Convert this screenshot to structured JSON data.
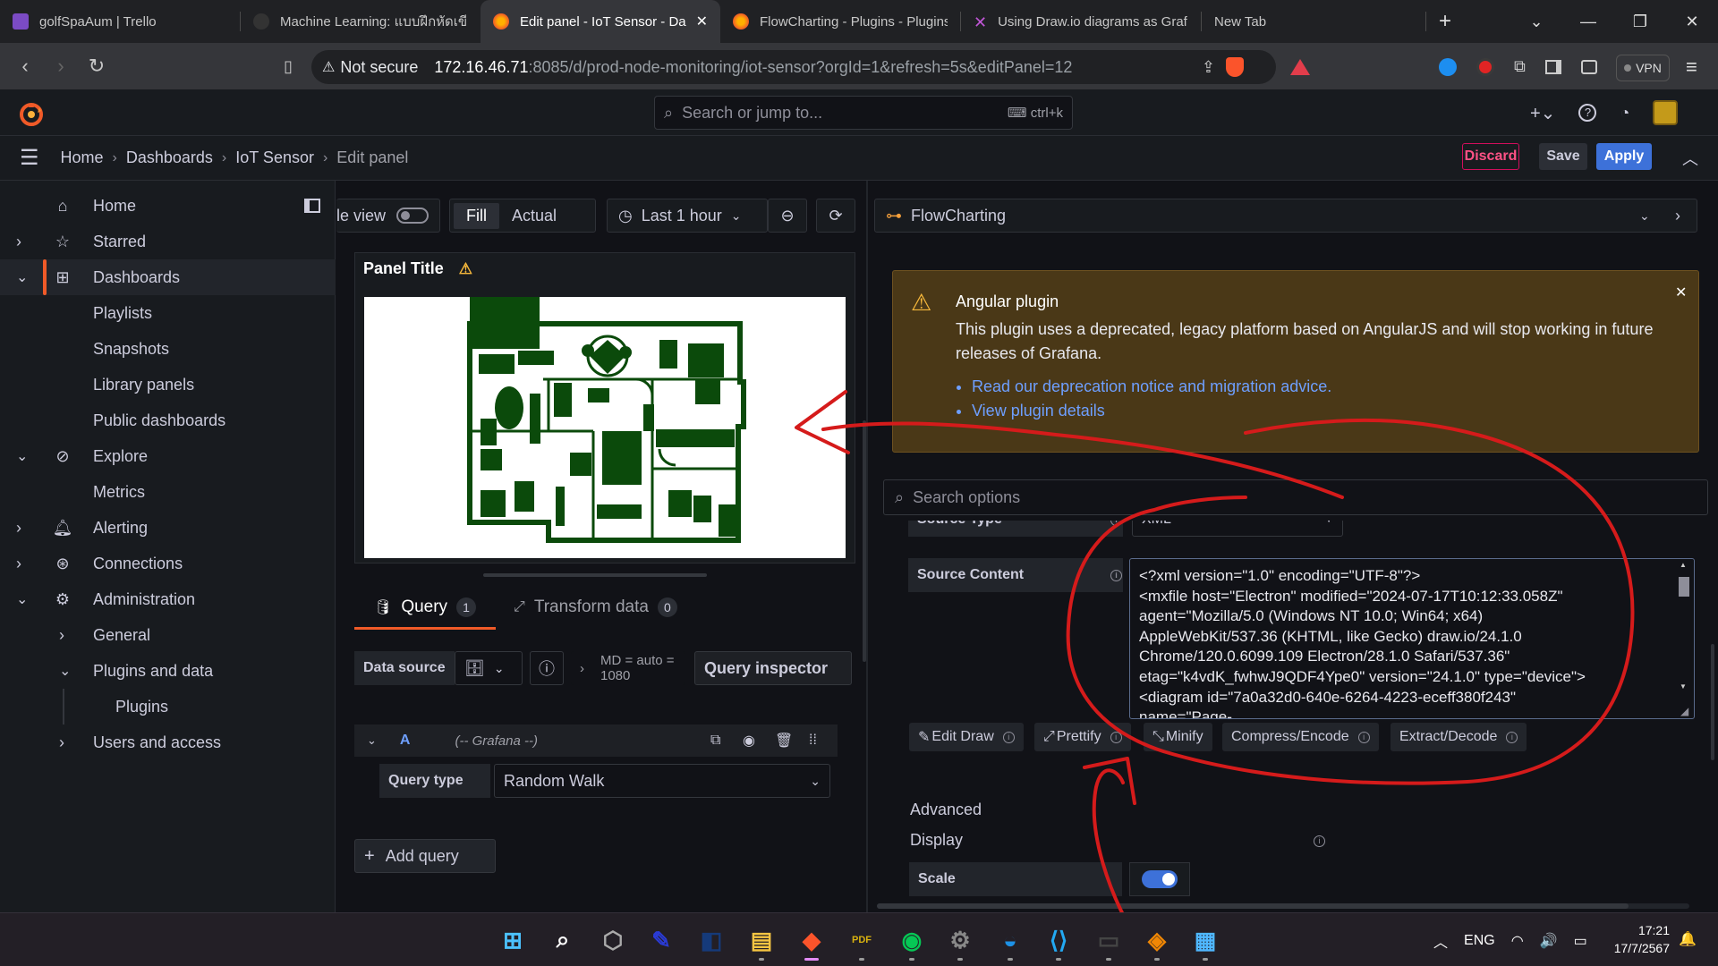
{
  "browser": {
    "tabs": [
      {
        "title": "golfSpaAum | Trello",
        "icon": "trello-icon",
        "color": "#7b4bc4"
      },
      {
        "title": "Machine Learning: แบบฝึกหัดเขียน",
        "icon": "github-icon",
        "color": "#333333"
      },
      {
        "title": "Edit panel - IoT Sensor - Da",
        "icon": "grafana-icon",
        "color": "#f05a28",
        "active": true
      },
      {
        "title": "FlowCharting - Plugins - Plugins",
        "icon": "grafana-icon",
        "color": "#f05a28"
      },
      {
        "title": "Using Draw.io diagrams as Graf",
        "icon": "close-x-icon",
        "color": "#c056d6"
      },
      {
        "title": "New Tab",
        "icon": "",
        "color": ""
      }
    ],
    "security_label": "Not secure",
    "url_host": "172.16.46.71",
    "url_path": ":8085/d/prod-node-monitoring/iot-sensor?orgId=1&refresh=5s&editPanel=12",
    "vpn_label": "VPN"
  },
  "grafana": {
    "search_placeholder": "Search or jump to...",
    "search_shortcut": "ctrl+k",
    "breadcrumb": [
      "Home",
      "Dashboards",
      "IoT Sensor",
      "Edit panel"
    ],
    "buttons": {
      "discard": "Discard",
      "save": "Save",
      "apply": "Apply"
    },
    "sidebar": [
      {
        "label": "Home",
        "icon": "home-icon",
        "level": 0,
        "chevron": ""
      },
      {
        "label": "Starred",
        "icon": "star-icon",
        "level": 0,
        "chevron": "right"
      },
      {
        "label": "Dashboards",
        "icon": "dashboards-icon",
        "level": 0,
        "chevron": "down",
        "active": true
      },
      {
        "label": "Playlists",
        "level": 1
      },
      {
        "label": "Snapshots",
        "level": 1
      },
      {
        "label": "Library panels",
        "level": 1
      },
      {
        "label": "Public dashboards",
        "level": 1
      },
      {
        "label": "Explore",
        "icon": "compass-icon",
        "level": 0,
        "chevron": "down"
      },
      {
        "label": "Metrics",
        "level": 1
      },
      {
        "label": "Alerting",
        "icon": "bell-icon",
        "level": 0,
        "chevron": "right"
      },
      {
        "label": "Connections",
        "icon": "connections-icon",
        "level": 0,
        "chevron": "right"
      },
      {
        "label": "Administration",
        "icon": "gear-icon",
        "level": 0,
        "chevron": "down"
      },
      {
        "label": "General",
        "level": 1,
        "chevron": "right"
      },
      {
        "label": "Plugins and data",
        "level": 1,
        "chevron": "down"
      },
      {
        "label": "Plugins",
        "level": 2
      },
      {
        "label": "Users and access",
        "level": 1,
        "chevron": "right"
      }
    ],
    "toolbar": {
      "table_view": "le view",
      "fill": "Fill",
      "actual": "Actual",
      "time_range": "Last 1 hour"
    },
    "panel": {
      "title": "Panel Title"
    },
    "query_tabs": {
      "query": "Query",
      "query_count": "1",
      "transform": "Transform data",
      "transform_count": "0"
    },
    "data_source": {
      "label": "Data source",
      "meta": "MD = auto = 1080",
      "inspector": "Query inspector"
    },
    "query_row": {
      "letter": "A",
      "source": "(-- Grafana --)",
      "query_type_label": "Query type",
      "query_type_value": "Random Walk"
    },
    "add_query": "Add query",
    "options": {
      "viz_name": "FlowCharting",
      "warning": {
        "title": "Angular plugin",
        "body": "This plugin uses a deprecated, legacy platform based on AngularJS and will stop working in future releases of Grafana.",
        "links": [
          "Read our deprecation notice and migration advice.",
          "View plugin details"
        ]
      },
      "search_placeholder": "Search options",
      "source_type_label": "Source Type",
      "source_type_value": "XML",
      "source_content_label": "Source Content",
      "source_content": "<?xml version=\"1.0\" encoding=\"UTF-8\"?>\n<mxfile host=\"Electron\" modified=\"2024-07-17T10:12:33.058Z\"\nagent=\"Mozilla/5.0 (Windows NT 10.0; Win64; x64)\nAppleWebKit/537.36 (KHTML, like Gecko) draw.io/24.1.0\nChrome/120.0.6099.109 Electron/28.1.0 Safari/537.36\"\netag=\"k4vdK_fwhwJ9QDF4Ype0\" version=\"24.1.0\" type=\"device\">\n<diagram id=\"7a0a32d0-640e-6264-4223-eceff380f243\"\nname=\"Page-",
      "actions": [
        "Edit Draw",
        "Prettify",
        "Minify",
        "Compress/Encode",
        "Extract/Decode"
      ],
      "advanced_label": "Advanced",
      "display_label": "Display",
      "scale_label": "Scale",
      "scale_on": true
    }
  },
  "taskbar": {
    "lang": "ENG",
    "time": "17:21",
    "date": "17/7/2567"
  },
  "colors": {
    "accent": "#f05a28",
    "primary": "#3d71d9",
    "warning_bg": "#4a3817",
    "annotation": "#d51b1b",
    "floorplan": "#0b4a0b"
  }
}
